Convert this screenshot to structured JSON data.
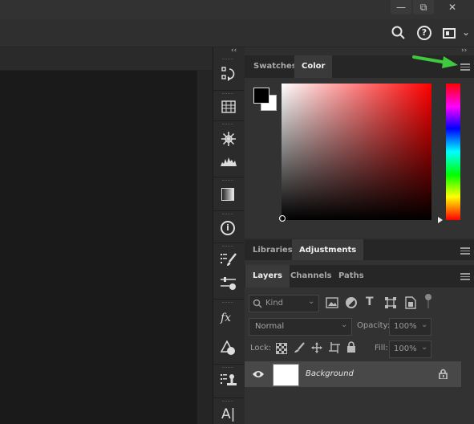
{
  "window": {
    "minimize_glyph": "—",
    "restore_glyph": "⧉",
    "close_glyph": "✕"
  },
  "optionsbar": {
    "search_icon": "search-icon",
    "help_glyph": "?",
    "workspace_icon": "workspace-icon",
    "dropdown_glyph": "⌄"
  },
  "collapse": {
    "left_glyph": "‹‹",
    "right_glyph": "››"
  },
  "iconstrip": {
    "items": [
      {
        "name": "history-icon",
        "glyph": "⎌"
      },
      {
        "name": "grid-icon",
        "glyph": "▦"
      },
      {
        "name": "navigator-wheel-icon",
        "glyph": "❋"
      },
      {
        "name": "histogram-icon",
        "glyph": "▟"
      },
      {
        "name": "gradient-icon",
        "glyph": "▨"
      },
      {
        "name": "info-icon",
        "glyph": "ⓘ"
      },
      {
        "name": "brush-presets-icon",
        "glyph": "✎"
      },
      {
        "name": "brush-settings-icon",
        "glyph": "⚟"
      },
      {
        "name": "styles-fx-icon",
        "glyph": "fx"
      },
      {
        "name": "shapes-icon",
        "glyph": "◭"
      },
      {
        "name": "clone-source-icon",
        "glyph": "⚲"
      },
      {
        "name": "character-icon",
        "glyph": "A|"
      }
    ]
  },
  "colorpanel": {
    "tabs": [
      "Swatches",
      "Color"
    ],
    "active_tab": "Color",
    "foreground": "#000000",
    "background": "#ffffff",
    "hue_selected": "#ff0000"
  },
  "adjpanel": {
    "tabs": [
      "Libraries",
      "Adjustments"
    ],
    "active_tab": "Adjustments"
  },
  "layerspanel": {
    "tabs": [
      "Layers",
      "Channels",
      "Paths"
    ],
    "active_tab": "Layers",
    "filter_value": "Kind",
    "blend_mode": "Normal",
    "opacity_label": "Opacity:",
    "opacity_value": "100%",
    "lock_label": "Lock:",
    "fill_label": "Fill:",
    "fill_value": "100%",
    "layers": [
      {
        "name": "Background",
        "visible": true,
        "locked": true
      }
    ]
  },
  "annotation": {
    "arrow_color": "#3ec93e"
  }
}
